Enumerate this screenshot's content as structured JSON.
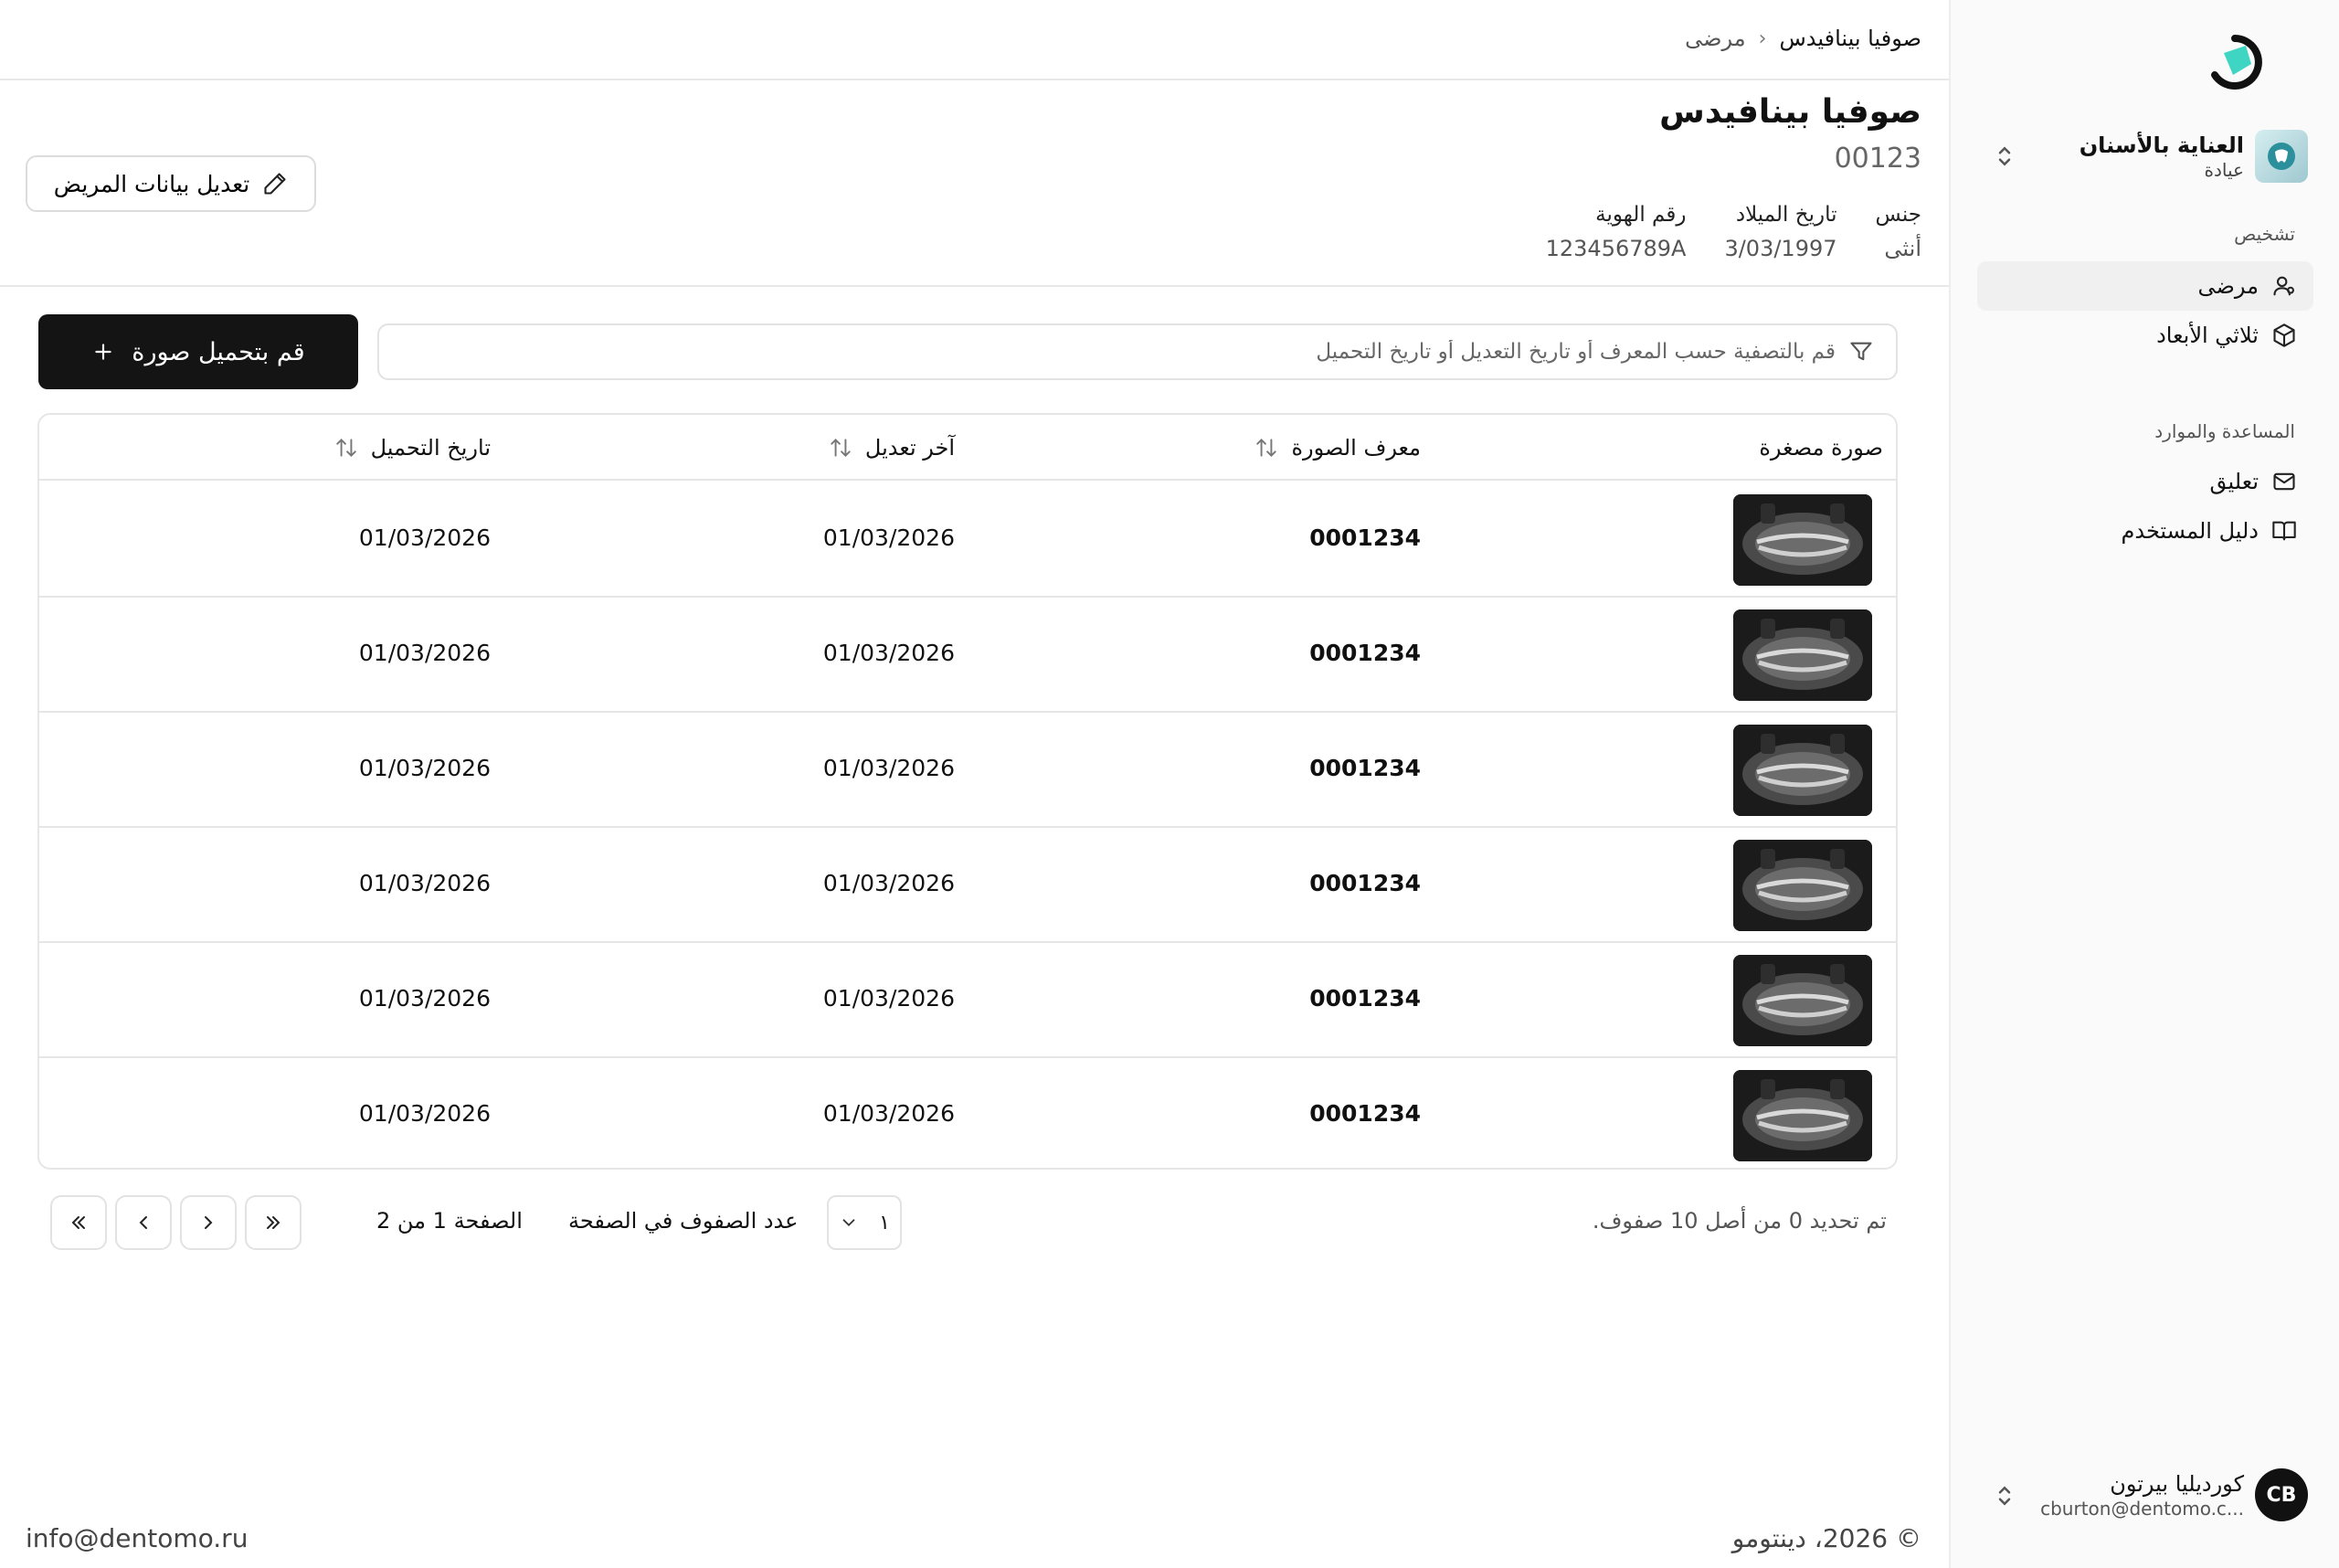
{
  "breadcrumb": {
    "current": "صوفيا بينافيدس",
    "parent": "مرضى"
  },
  "patient": {
    "name": "صوفيا بينافيدس",
    "id": "00123",
    "gender_label": "جنس",
    "gender_value": "أنثى",
    "dob_label": "تاريخ الميلاد",
    "dob_value": "3/03/1997",
    "idnum_label": "رقم الهوية",
    "idnum_value": "123456789A"
  },
  "edit_button": "تعديل بيانات المريض",
  "filter": {
    "placeholder": "قم بالتصفية حسب المعرف أو تاريخ التعديل أو تاريخ التحميل"
  },
  "upload_button": "قم بتحميل صورة",
  "table": {
    "headers": {
      "thumbnail": "صورة مصغرة",
      "image_id": "معرف الصورة",
      "modified": "آخر تعديل",
      "uploaded": "تاريخ التحميل"
    },
    "rows": [
      {
        "id": "0001234",
        "modified": "01/03/2026",
        "uploaded": "01/03/2026"
      },
      {
        "id": "0001234",
        "modified": "01/03/2026",
        "uploaded": "01/03/2026"
      },
      {
        "id": "0001234",
        "modified": "01/03/2026",
        "uploaded": "01/03/2026"
      },
      {
        "id": "0001234",
        "modified": "01/03/2026",
        "uploaded": "01/03/2026"
      },
      {
        "id": "0001234",
        "modified": "01/03/2026",
        "uploaded": "01/03/2026"
      },
      {
        "id": "0001234",
        "modified": "01/03/2026",
        "uploaded": "01/03/2026"
      }
    ]
  },
  "pagination": {
    "selected_info": "تم تحديد 0 من أصل 10 صفوف.",
    "rows_per_page_label": "عدد الصفوف في الصفحة",
    "rows_per_page_value": "١",
    "page_label": "الصفحة 1 من 2"
  },
  "sidebar": {
    "org_name": "العناية بالأسنان",
    "org_sub": "عيادة",
    "section_diagnosis": "تشخيص",
    "nav_patients": "مرضى",
    "nav_3d": "ثلاثي الأبعاد",
    "section_help": "المساعدة والموارد",
    "nav_feedback": "تعليق",
    "nav_guide": "دليل المستخدم",
    "user_initials": "CB",
    "user_name": "كورديليا بيرتون",
    "user_email": "cburton@dentomo.c..."
  },
  "footer": {
    "email": "info@dentomo.ru",
    "copyright": "© 2026، دينتومو"
  },
  "colors": {
    "brand_teal": "#3ed6c2",
    "primary_button": "#141414"
  }
}
